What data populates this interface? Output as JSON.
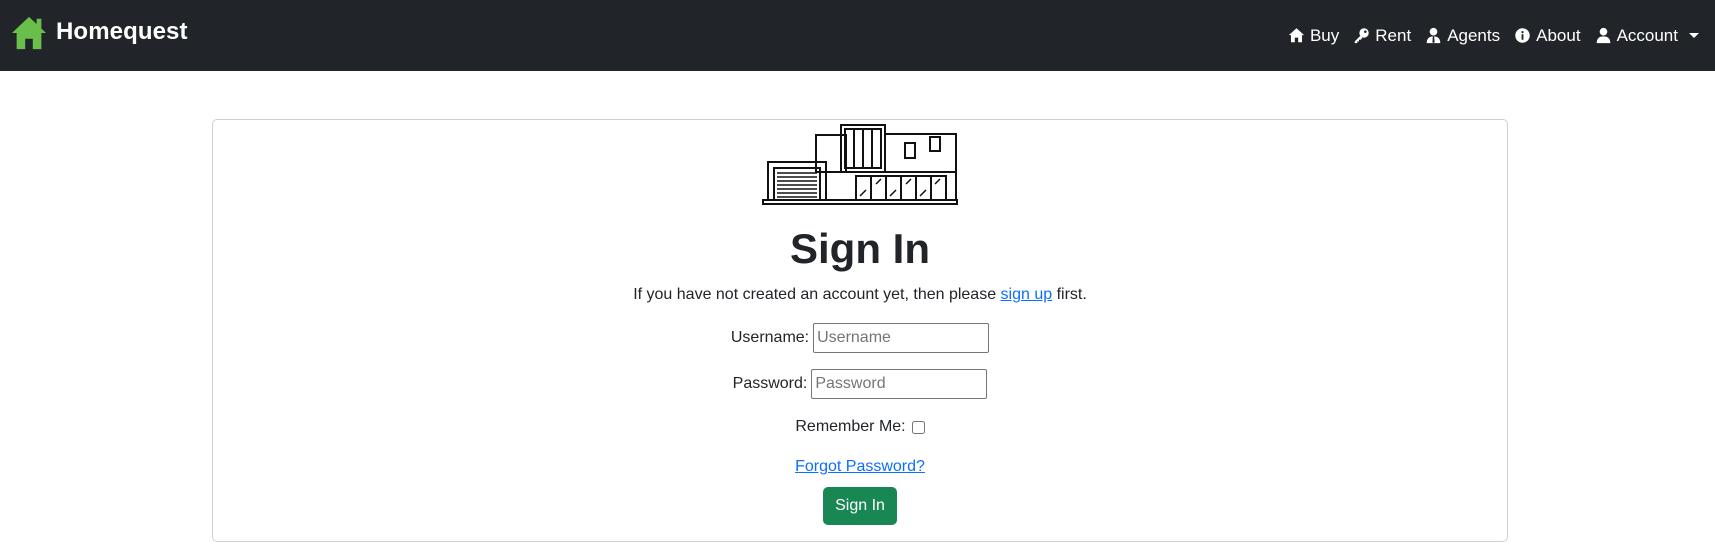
{
  "navbar": {
    "brand": "Homequest",
    "items": [
      {
        "label": "Buy",
        "icon": "home-icon"
      },
      {
        "label": "Rent",
        "icon": "key-icon"
      },
      {
        "label": "Agents",
        "icon": "agent-icon"
      },
      {
        "label": "About",
        "icon": "info-icon"
      },
      {
        "label": "Account",
        "icon": "user-icon"
      }
    ]
  },
  "signin": {
    "title": "Sign In",
    "intro_before": "If you have not created an account yet, then please ",
    "intro_link": "sign up",
    "intro_after": " first.",
    "username_label": "Username:",
    "username_placeholder": "Username",
    "username_value": "",
    "password_label": "Password:",
    "password_placeholder": "Password",
    "password_value": "",
    "remember_label": "Remember Me:",
    "remember_checked": false,
    "forgot_label": "Forgot Password?",
    "submit_label": "Sign In"
  },
  "colors": {
    "navbar_bg": "#212529",
    "brand_icon": "#6abf4b",
    "link": "#0d6efd",
    "button": "#198754"
  }
}
